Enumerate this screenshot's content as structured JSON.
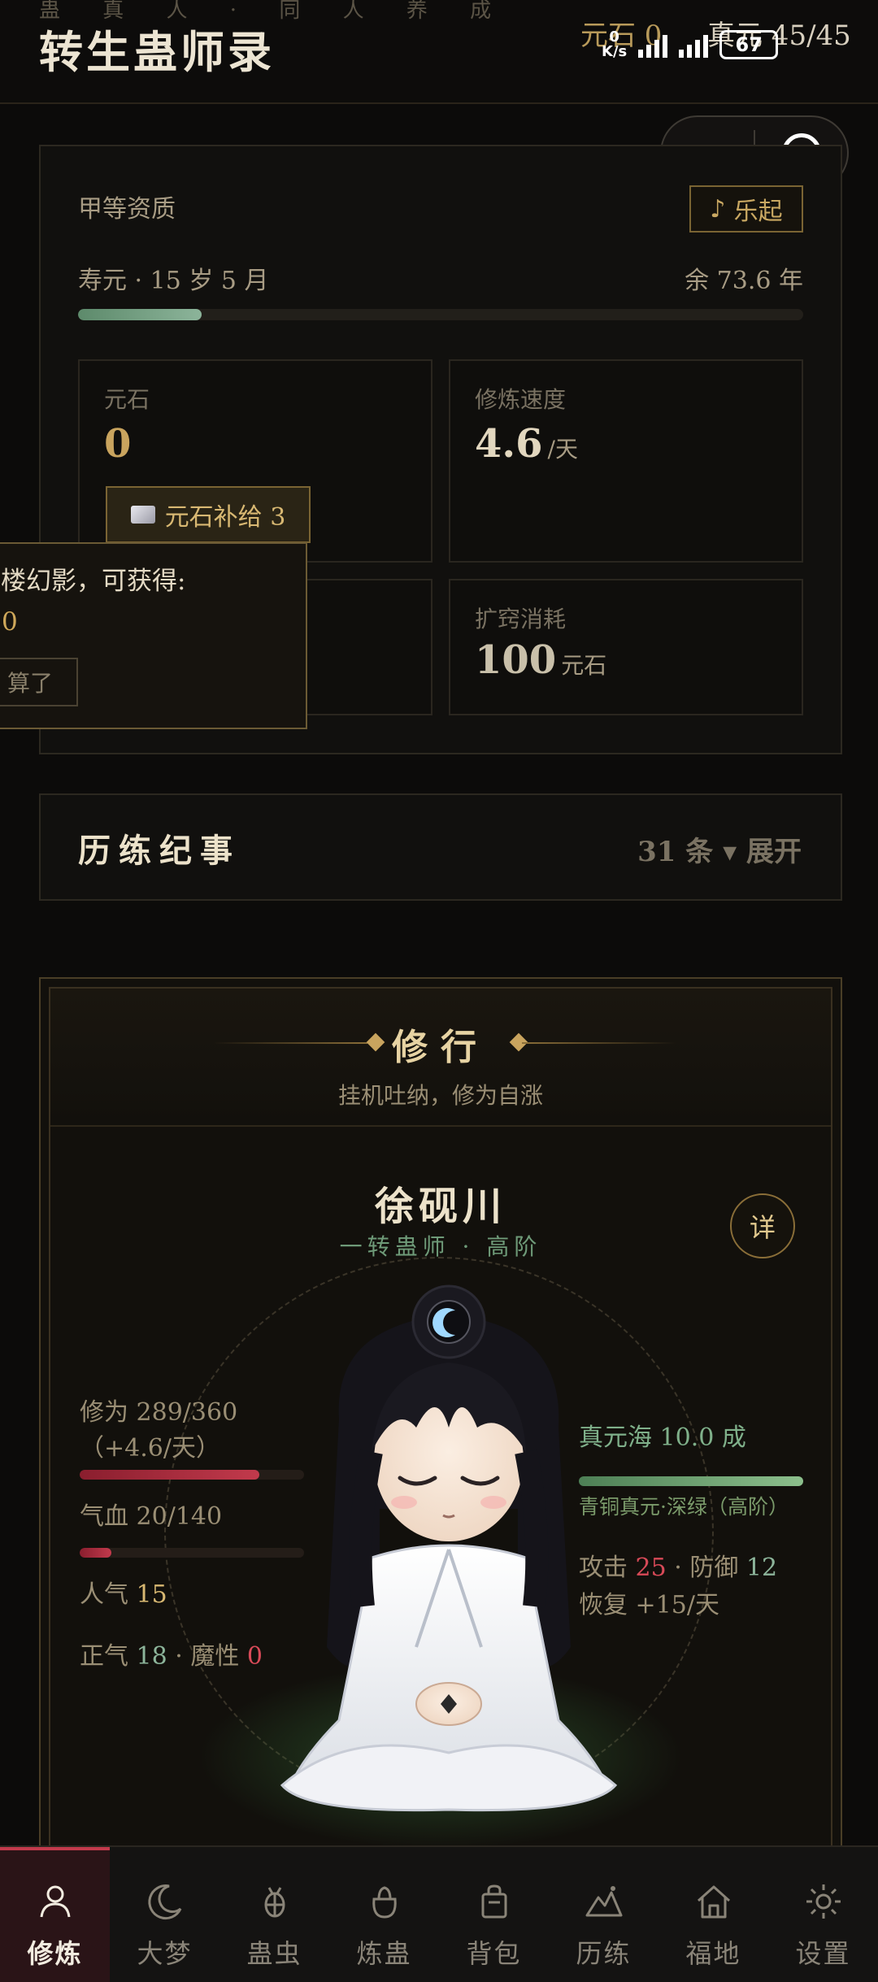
{
  "header": {
    "subtitle": "蛊 真 人 · 同 人 养 成",
    "title": "转生蛊师录",
    "stone_label": "元石 0",
    "energy_label": "真元 45/45",
    "status_bar": {
      "speed_value": "0",
      "speed_unit": "K/s",
      "battery": "67"
    }
  },
  "status_card": {
    "quality": "甲等资质",
    "music_button": "乐起",
    "lifespan": "寿元 · 15 岁 5 月",
    "lifespan_left": "余 73.6 年",
    "lifespan_fraction": 0.17,
    "stats": [
      {
        "label": "元石",
        "value": "0",
        "unit": ""
      },
      {
        "label": "修炼速度",
        "value": "4.6",
        "unit": "/天"
      },
      {
        "label": "扩窍消耗",
        "value": "100",
        "unit": "元石"
      }
    ],
    "refill_button": "元石补给 3"
  },
  "popup": {
    "text": "蜃楼幻影，可获得:",
    "value": "0",
    "cancel": "算了"
  },
  "chronicle": {
    "title": "历练纪事",
    "count": "31 条 ▾ 展开"
  },
  "cultivation": {
    "title": "修行",
    "subtitle": "挂机吐纳，修为自涨",
    "name": "徐砚川",
    "rank": "一转蛊师 · 高阶",
    "detail_button": "详",
    "xp_label": "修为 289/360（+4.6/天）",
    "xp_fraction": 0.8,
    "hp_label": "气血 20/140",
    "hp_fraction": 0.14,
    "popularity_label": "人气",
    "popularity_value": "15",
    "righteous_label": "正气",
    "righteous_value": "18",
    "demonic_label": "魔性",
    "demonic_value": "0",
    "sea_label": "真元海 10.0 成",
    "sea_fraction": 1.0,
    "sea_grade": "青铜真元·深绿（高阶）",
    "attack_label": "攻击",
    "attack_value": "25",
    "defense_label": "防御",
    "defense_value": "12",
    "recovery": "恢复 +15/天"
  },
  "nav": [
    {
      "label": "修炼",
      "icon": "person-icon",
      "active": true
    },
    {
      "label": "大梦",
      "icon": "moon-icon",
      "active": false
    },
    {
      "label": "蛊虫",
      "icon": "bug-icon",
      "active": false
    },
    {
      "label": "炼蛊",
      "icon": "cauldron-icon",
      "active": false
    },
    {
      "label": "背包",
      "icon": "bag-icon",
      "active": false
    },
    {
      "label": "历练",
      "icon": "mountain-icon",
      "active": false
    },
    {
      "label": "福地",
      "icon": "home-icon",
      "active": false
    },
    {
      "label": "设置",
      "icon": "gear-icon",
      "active": false
    }
  ],
  "colors": {
    "accent_gold": "#c9a45e",
    "accent_red": "#c23a4c",
    "accent_green": "#8cb49a",
    "background": "#0c0b0a"
  }
}
